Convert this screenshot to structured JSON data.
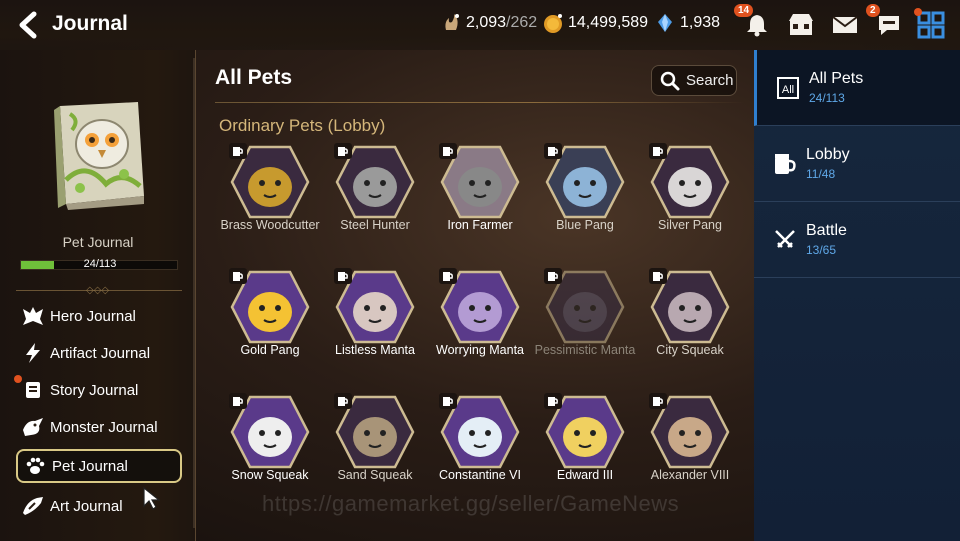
{
  "header": {
    "back_label": "Back",
    "title": "Journal",
    "resources": [
      {
        "icon": "stamina-icon",
        "value": "2,093",
        "sub": "/262"
      },
      {
        "icon": "gold-icon",
        "value": "14,499,589",
        "sub": ""
      },
      {
        "icon": "crystal-icon",
        "value": "1,938",
        "sub": ""
      }
    ],
    "notifications_badge": "14",
    "chat_badge": "2"
  },
  "left": {
    "journal_label": "Pet Journal",
    "progress_text": "24/113",
    "progress_fraction": 0.212,
    "menu": [
      {
        "label": "Hero Journal",
        "icon": "hero-icon"
      },
      {
        "label": "Artifact Journal",
        "icon": "lightning-icon"
      },
      {
        "label": "Story Journal",
        "icon": "scroll-icon",
        "dot": true
      },
      {
        "label": "Monster Journal",
        "icon": "monster-icon"
      },
      {
        "label": "Pet Journal",
        "icon": "paw-icon",
        "active": true
      },
      {
        "label": "Art Journal",
        "icon": "brush-icon"
      }
    ]
  },
  "main": {
    "title": "All Pets",
    "search_label": "Search",
    "section_title": "Ordinary Pets (Lobby)",
    "pets": [
      {
        "name": "Brass Woodcutter",
        "state": "normal",
        "color": "#3a2a3f",
        "body": "#c79a2e"
      },
      {
        "name": "Steel Hunter",
        "state": "normal",
        "color": "#3a2a3f",
        "body": "#9a9a9a"
      },
      {
        "name": "Iron Farmer",
        "state": "bright",
        "color": "#8a7a86",
        "body": "#888888"
      },
      {
        "name": "Blue Pang",
        "state": "normal",
        "color": "#3a3f55",
        "body": "#8db3d6"
      },
      {
        "name": "Silver Pang",
        "state": "normal",
        "color": "#3a2a3f",
        "body": "#d9d6d6"
      },
      {
        "name": "Gold Pang",
        "state": "bright",
        "color": "#5a3a8a",
        "body": "#f4c233"
      },
      {
        "name": "Listless Manta",
        "state": "bright",
        "color": "#5a3a8a",
        "body": "#d8c7c1"
      },
      {
        "name": "Worrying Manta",
        "state": "bright",
        "color": "#5a3a8a",
        "body": "#b39bd3"
      },
      {
        "name": "Pessimistic Manta",
        "state": "dim",
        "color": "#3a2f45",
        "body": "#5e5870"
      },
      {
        "name": "City Squeak",
        "state": "normal",
        "color": "#3a2a3f",
        "body": "#b8a8b0"
      },
      {
        "name": "Snow Squeak",
        "state": "bright",
        "color": "#5a3a8a",
        "body": "#eeeeee"
      },
      {
        "name": "Sand Squeak",
        "state": "normal",
        "color": "#3a2a3f",
        "body": "#a89478"
      },
      {
        "name": "Constantine VI",
        "state": "bright",
        "color": "#5a3a8a",
        "body": "#e4eef6"
      },
      {
        "name": "Edward III",
        "state": "bright",
        "color": "#5a3a8a",
        "body": "#f0d060"
      },
      {
        "name": "Alexander VIII",
        "state": "normal",
        "color": "#3a2a3f",
        "body": "#c8a888"
      }
    ]
  },
  "right": {
    "categories": [
      {
        "name": "All Pets",
        "count": "24/113",
        "icon": "all-icon",
        "active": true
      },
      {
        "name": "Lobby",
        "count": "11/48",
        "icon": "mug-icon"
      },
      {
        "name": "Battle",
        "count": "13/65",
        "icon": "swords-icon"
      }
    ]
  },
  "watermark": "https://gamemarket.gg/seller/GameNews"
}
